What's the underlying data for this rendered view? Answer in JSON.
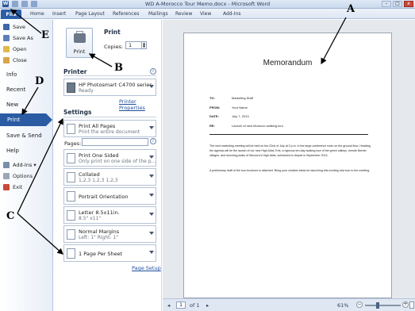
{
  "window": {
    "title": "WD A-Morocco Tour Memo.docx - Microsoft Word",
    "word_icon": "W",
    "quick_access": [
      "save-icon",
      "undo-icon",
      "redo-icon"
    ],
    "controls": [
      "-",
      "□",
      "x"
    ]
  },
  "ribbon_tabs": [
    "File",
    "Home",
    "Insert",
    "Page Layout",
    "References",
    "Mailings",
    "Review",
    "View",
    "Add-Ins"
  ],
  "nav": {
    "save": "Save",
    "save_as": "Save As",
    "open": "Open",
    "close": "Close",
    "info": "Info",
    "recent": "Recent",
    "new": "New",
    "print": "Print",
    "save_send": "Save & Send",
    "help": "Help",
    "addins": "Add-Ins ▾",
    "options": "Options",
    "exit": "Exit"
  },
  "print": {
    "heading": "Print",
    "button_label": "Print",
    "copies_label": "Copies:",
    "copies_value": "1"
  },
  "printer": {
    "heading": "Printer",
    "name": "HP Photosmart C4700 series",
    "status": "Ready",
    "properties_link": "Printer Properties"
  },
  "settings": {
    "heading": "Settings",
    "print_what": {
      "title": "Print All Pages",
      "sub": "Print the entire document"
    },
    "pages_label": "Pages:",
    "sided": {
      "title": "Print One Sided",
      "sub": "Only print on one side of the p..."
    },
    "collated": {
      "title": "Collated",
      "sub": "1,2,3   1,2,3   1,2,3"
    },
    "orientation": {
      "title": "Portrait Orientation"
    },
    "paper": {
      "title": "Letter 8.5x11in.",
      "sub": "8.5\" x11\""
    },
    "margins": {
      "title": "Normal Margins",
      "sub": "Left: 1\"   Right: 1\""
    },
    "per_sheet": {
      "title": "1 Page Per Sheet"
    },
    "page_setup_link": "Page Setup"
  },
  "preview": {
    "memo_title": "Memorandum",
    "fields": [
      {
        "key": "TO:",
        "value": "Marketing Staff"
      },
      {
        "key": "FROM:",
        "value": "Your Name"
      },
      {
        "key": "DATE:",
        "value": "July 7, 2013"
      },
      {
        "key": "RE:",
        "value": "Launch of new Morocco walking tour"
      }
    ],
    "paragraph1": "The next marketing meeting will be held on the 22nd of July at 3 p.m. in the large conference room on the ground floor. Heading the agenda will be the launch of our new High Atlas Trek, a rigorous ten-day walking tour of the green valleys, remote Berber villages, and stunning peaks of Morocco's High Atlas, scheduled to depart in September 2013.",
    "paragraph2": "A preliminary draft of the tour brochure is attached. Bring your creative ideas for launching this exciting new tour to the meeting."
  },
  "statusbar": {
    "page_current": "1",
    "page_total": "of 1",
    "zoom": "61%",
    "zoom_fraction": 0.61
  },
  "callouts": [
    "A",
    "B",
    "C",
    "D",
    "E"
  ]
}
